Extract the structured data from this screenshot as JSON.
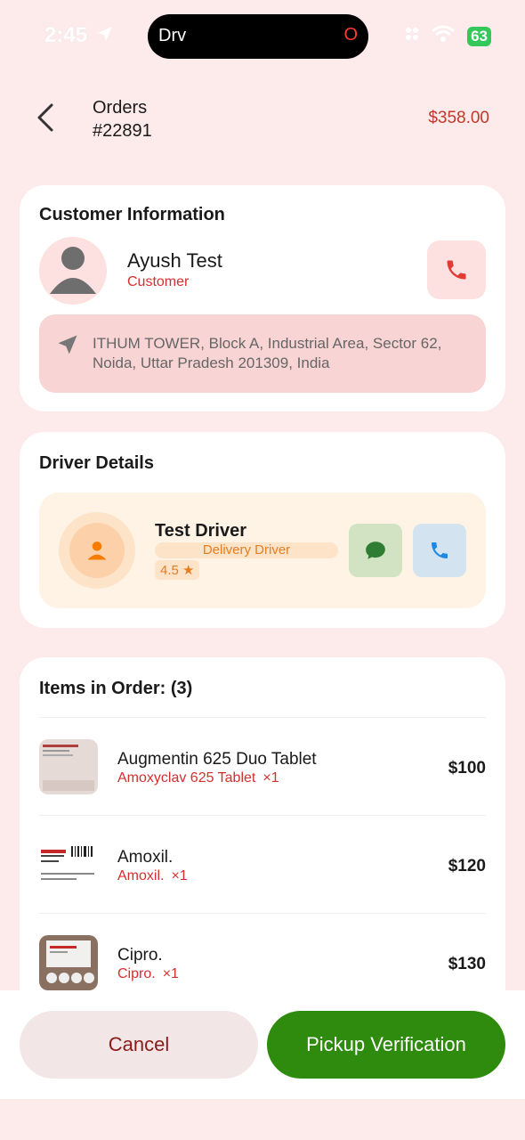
{
  "status_bar": {
    "time": "2:45",
    "island_label": "Drv",
    "island_indicator": "O",
    "battery": "63"
  },
  "header": {
    "title_line1": "Orders",
    "title_line2": "#22891",
    "total": "$358.00"
  },
  "customer": {
    "section_title": "Customer Information",
    "name": "Ayush Test",
    "role": "Customer",
    "address": "ITHUM TOWER, Block A, Industrial Area, Sector 62, Noida, Uttar Pradesh 201309, India"
  },
  "driver": {
    "section_title": "Driver Details",
    "name": "Test Driver",
    "role": "Delivery Driver",
    "rating": "4.5 ★"
  },
  "items": {
    "section_title": "Items in Order: (3)",
    "list": [
      {
        "name": "Augmentin 625 Duo Tablet",
        "generic": "Amoxyclav 625 Tablet",
        "qty": "×1",
        "price": "$100"
      },
      {
        "name": "Amoxil.",
        "generic": "Amoxil.",
        "qty": "×1",
        "price": "$120"
      },
      {
        "name": "Cipro.",
        "generic": "Cipro.",
        "qty": "×1",
        "price": "$130"
      }
    ]
  },
  "actions": {
    "cancel_label": "Cancel",
    "pickup_label": "Pickup Verification"
  },
  "colors": {
    "background": "#fdeaea",
    "accent_red": "#d32f2f",
    "price_red": "#c0392b",
    "driver_orange": "#e67e22",
    "pickup_green": "#2e8b0e"
  },
  "icons": [
    "location-arrow-icon",
    "wifi-icon",
    "back-chevron-icon",
    "avatar-icon",
    "phone-icon",
    "navigation-arrow-icon",
    "chat-icon",
    "driver-person-icon"
  ]
}
